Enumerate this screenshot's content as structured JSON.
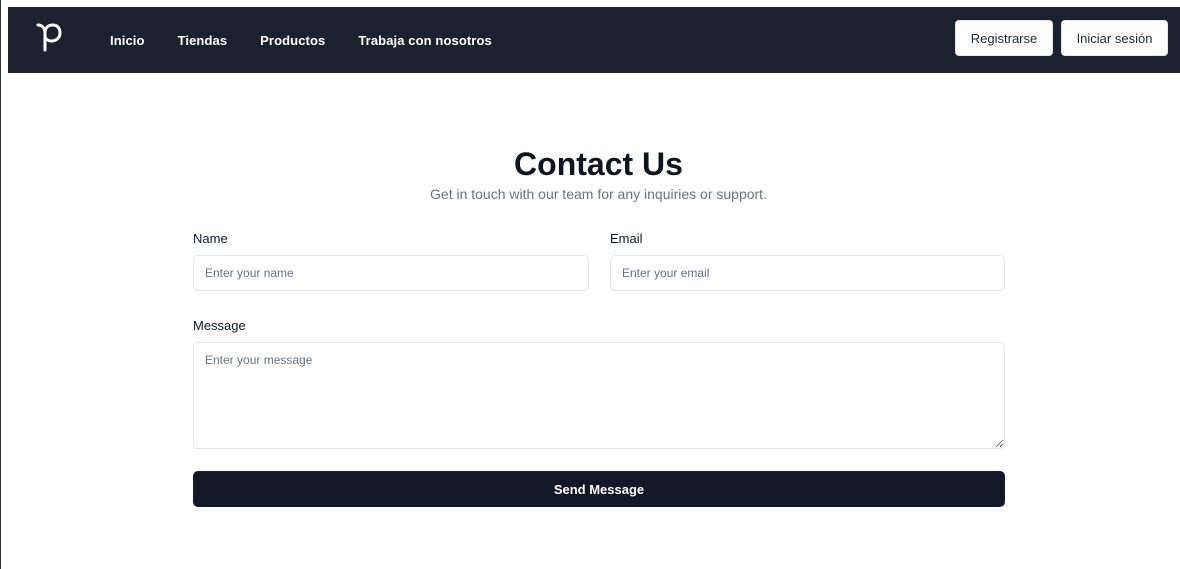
{
  "nav": {
    "links": [
      "Inicio",
      "Tiendas",
      "Productos",
      "Trabaja con nosotros"
    ],
    "register_label": "Registrarse",
    "login_label": "Iniciar sesión"
  },
  "page": {
    "title": "Contact Us",
    "subtitle": "Get in touch with our team for any inquiries or support."
  },
  "form": {
    "name_label": "Name",
    "name_placeholder": "Enter your name",
    "email_label": "Email",
    "email_placeholder": "Enter your email",
    "message_label": "Message",
    "message_placeholder": "Enter your message",
    "submit_label": "Send Message"
  },
  "colors": {
    "navbar": "#1b222d",
    "button_dark": "#121826",
    "muted_text": "#6b7280"
  },
  "icons": {
    "logo": "p-logo-icon"
  }
}
